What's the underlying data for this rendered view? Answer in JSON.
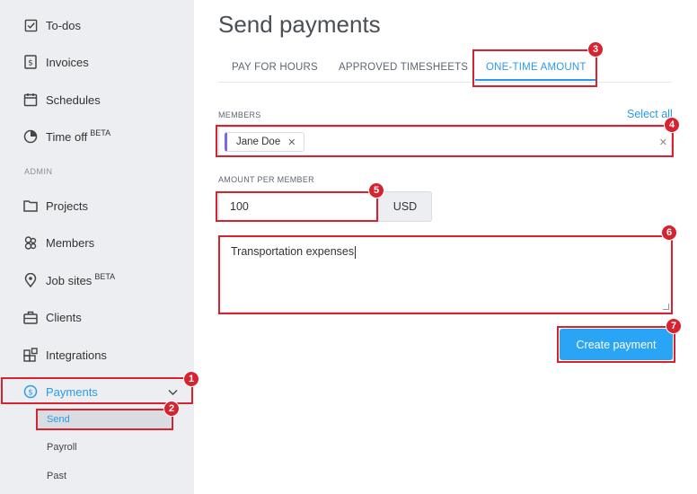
{
  "sidebar": {
    "items": [
      {
        "label": "To-dos",
        "icon": "checkbox-icon"
      },
      {
        "label": "Invoices",
        "icon": "dollar-document-icon"
      },
      {
        "label": "Schedules",
        "icon": "calendar-icon"
      },
      {
        "label": "Time off",
        "badge": "BETA",
        "icon": "pie-chart-icon"
      }
    ],
    "section_label": "ADMIN",
    "admin_items": [
      {
        "label": "Projects",
        "icon": "folder-icon"
      },
      {
        "label": "Members",
        "icon": "members-icon"
      },
      {
        "label": "Job sites",
        "badge": "BETA",
        "icon": "location-pin-icon"
      },
      {
        "label": "Clients",
        "icon": "briefcase-icon"
      },
      {
        "label": "Integrations",
        "icon": "integrations-icon"
      },
      {
        "label": "Payments",
        "icon": "dollar-circle-icon"
      }
    ],
    "payments_sub": [
      {
        "label": "Send"
      },
      {
        "label": "Payroll"
      },
      {
        "label": "Past"
      }
    ]
  },
  "main": {
    "title": "Send payments",
    "tabs": [
      {
        "label": "PAY FOR HOURS"
      },
      {
        "label": "APPROVED TIMESHEETS"
      },
      {
        "label": "ONE-TIME AMOUNT"
      }
    ],
    "members_label": "MEMBERS",
    "select_all": "Select all",
    "member_chip": "Jane Doe",
    "amount_label": "AMOUNT PER MEMBER",
    "amount_value": "100",
    "currency": "USD",
    "note_value": "Transportation expenses",
    "create_button": "Create payment"
  },
  "annotations": [
    "1",
    "2",
    "3",
    "4",
    "5",
    "6",
    "7"
  ],
  "colors": {
    "accent": "#2a9be9",
    "annotation": "#d7232f",
    "sidebar_bg": "#eceef1",
    "chip_accent": "#7b68ee"
  }
}
